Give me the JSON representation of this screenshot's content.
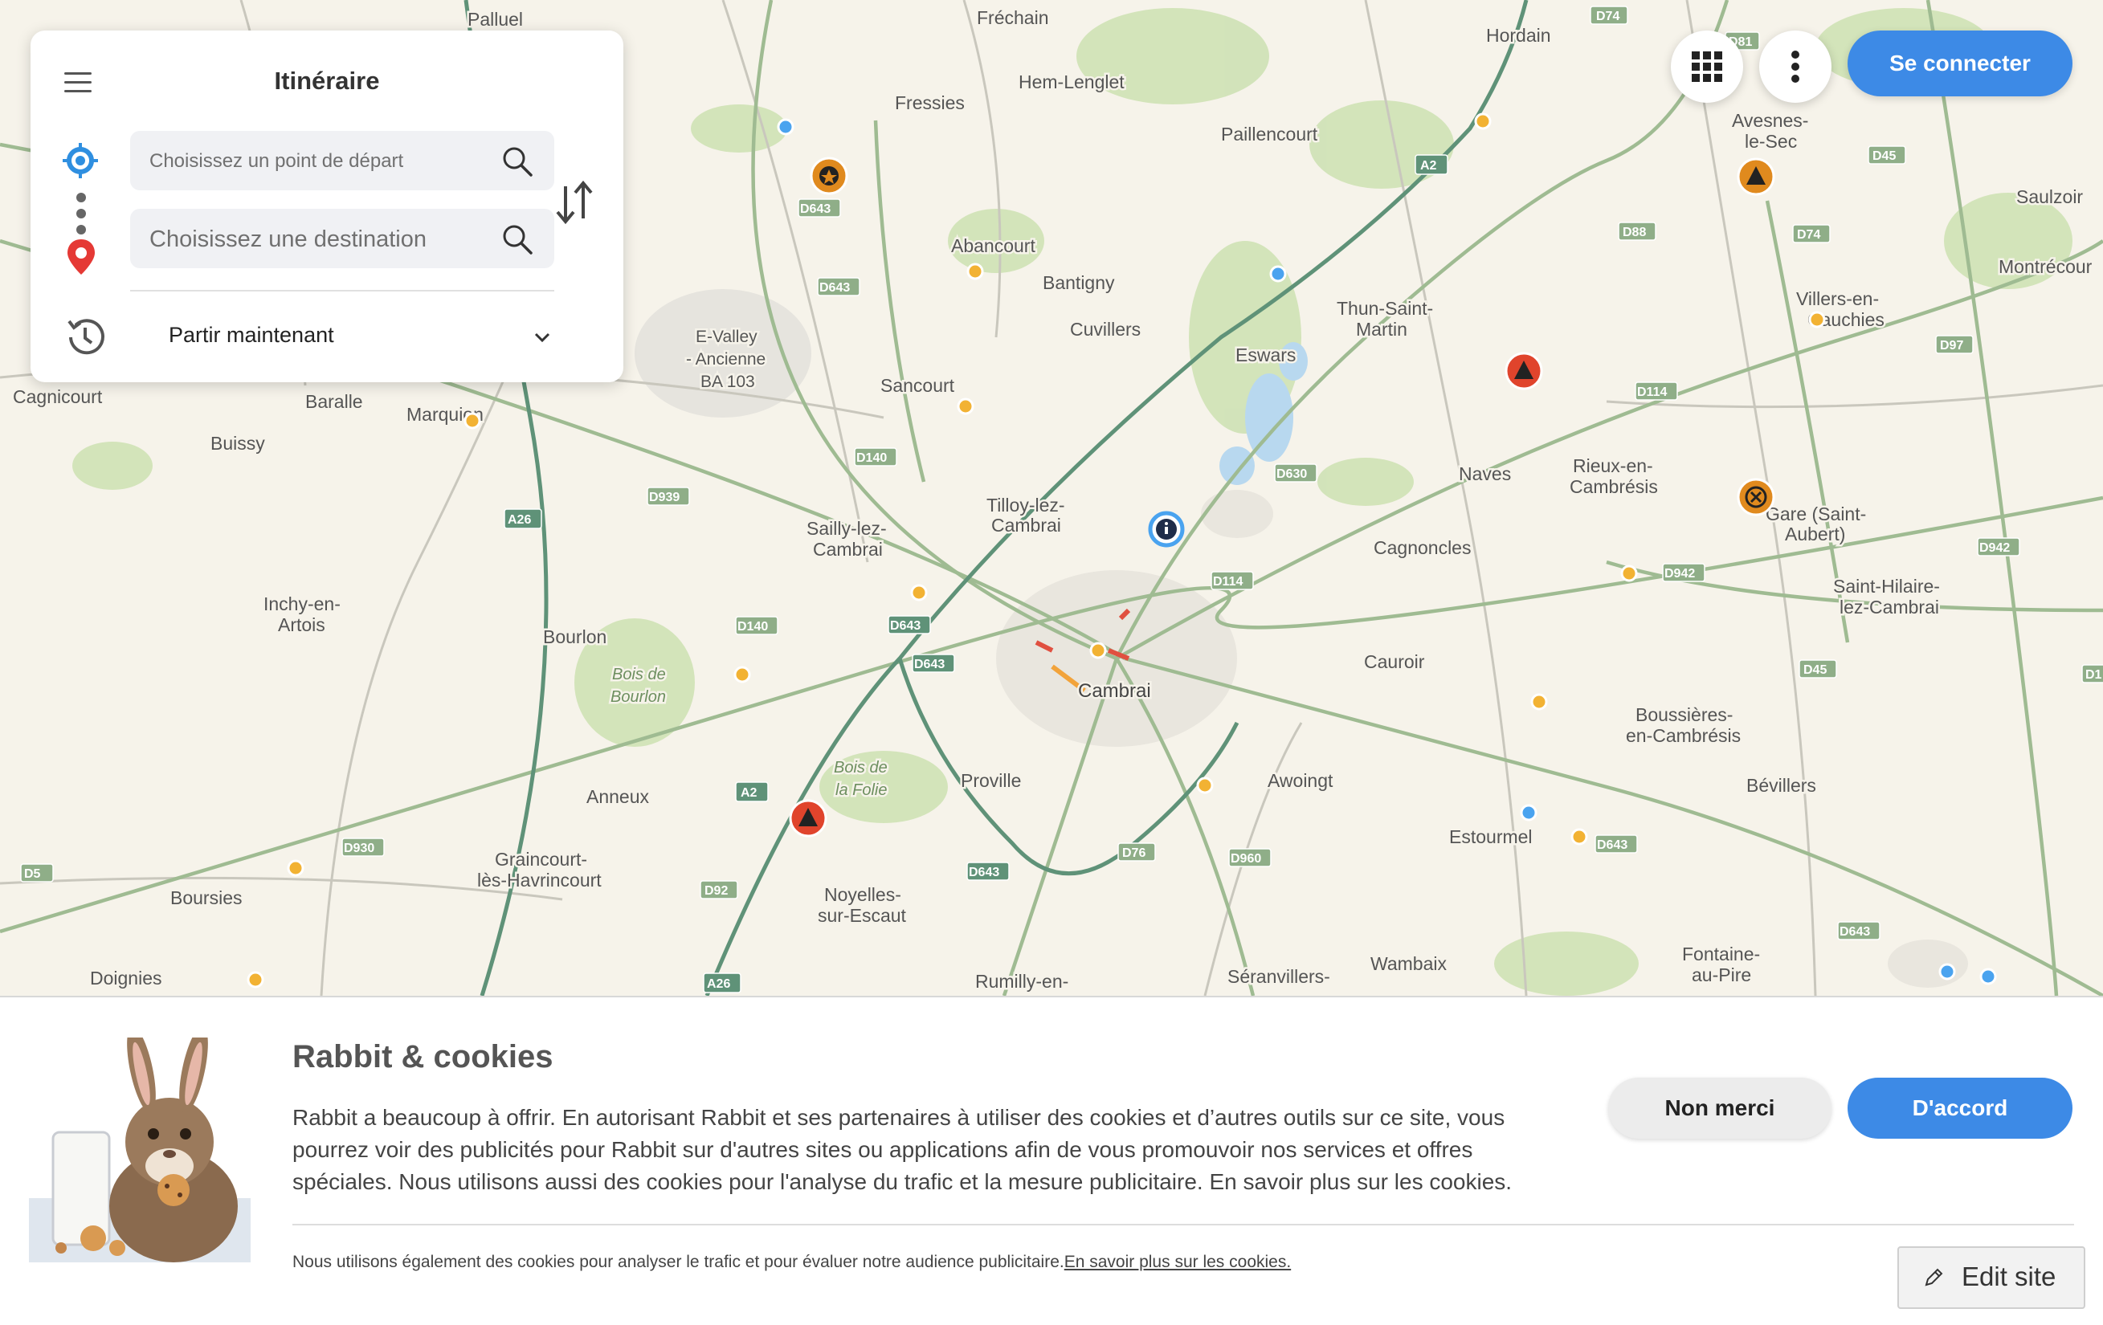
{
  "panel": {
    "title": "Itinéraire",
    "start_placeholder": "Choisissez un point de départ",
    "dest_placeholder": "Choisissez une destination",
    "depart_label": "Partir maintenant"
  },
  "header": {
    "login_label": "Se connecter"
  },
  "map": {
    "places": [
      "Palluel",
      "Fréchain",
      "Hordain",
      "Fressies",
      "Hem-Lenglet",
      "Paillencourt",
      "Avesnes-",
      "le-Sec",
      "Saulzoir",
      "Abancourt",
      "Bantigny",
      "Montrécour",
      "Villers-en-",
      "Cauchies",
      "Cuvillers",
      "Eswars",
      "Thun-Saint-",
      "Martin",
      "E-Valley",
      "- Ancienne",
      "BA 103",
      "Sancourt",
      "Cagnicourt",
      "Baralle",
      "Marquion",
      "Buissy",
      "Naves",
      "Rieux-en-",
      "Cambrésis",
      "Tilloy-lez-",
      "Cambrai",
      "Sailly-lez-",
      "Cambrai",
      "Gare (Saint-",
      "Aubert)",
      "Cagnoncles",
      "Saint-Hilaire-",
      "lez-Cambrai",
      "Inchy-en-",
      "Artois",
      "Bourlon",
      "Bois de",
      "Bourlon",
      "Cambrai",
      "Cauroir",
      "Boussières-",
      "en-Cambrésis",
      "Awoingt",
      "Proville",
      "Bois de",
      "la Folie",
      "Anneux",
      "Bévillers",
      "Estourmel",
      "Graincourt-",
      "lès-Havrincourt",
      "Boursies",
      "Noyelles-",
      "sur-Escaut",
      "Doignies",
      "Wambaix",
      "Fontaine-",
      "au-Pire",
      "Rumilly-en-",
      "Séranvillers-"
    ],
    "roads": [
      "D74",
      "D81",
      "D45",
      "A2",
      "D643",
      "D88",
      "D74",
      "D643",
      "D97",
      "D114",
      "D630",
      "D140",
      "D939",
      "A26",
      "D942",
      "D942",
      "D643",
      "D140",
      "D643",
      "D643",
      "D45",
      "D114",
      "A2",
      "D930",
      "D5",
      "D92",
      "D76",
      "D960",
      "D643",
      "D643",
      "D643",
      "A26",
      "D1"
    ]
  },
  "cookie": {
    "title": "Rabbit & cookies",
    "body": "Rabbit a beaucoup à offrir. En autorisant Rabbit et ses partenaires à utiliser des cookies et d’autres outils sur ce site, vous pourrez voir des publicités pour Rabbit sur d'autres sites ou applications afin de vous promouvoir nos services et offres spéciales. Nous utilisons aussi des cookies pour l'analyse du trafic et la mesure publicitaire. En savoir plus sur les cookies.",
    "footnote": "Nous utilisons également des cookies pour analyser le trafic et pour évaluer notre audience publicitaire.",
    "footnote_link": "En savoir plus sur les cookies.",
    "no_label": "Non merci",
    "yes_label": "D'accord",
    "edit_label": "Edit site"
  },
  "colors": {
    "accent": "#3d8ae6",
    "start_pin": "#2f8fe0",
    "dest_pin": "#e53935",
    "incident_red": "#e0442c",
    "incident_orange": "#e08a1e",
    "camera_yellow": "#f2b233"
  }
}
